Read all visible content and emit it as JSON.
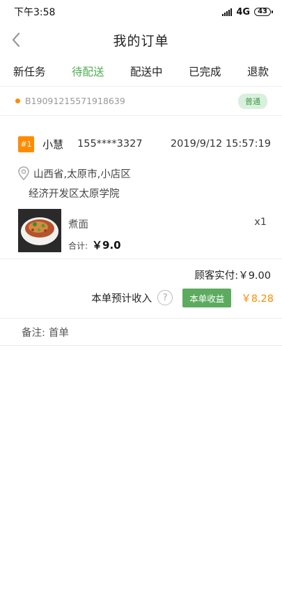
{
  "status_bar": {
    "time": "下午3:58",
    "network": "4G",
    "battery": "43"
  },
  "header": {
    "title": "我的订单"
  },
  "tabs": [
    {
      "label": "新任务"
    },
    {
      "label": "待配送",
      "active": true
    },
    {
      "label": "配送中"
    },
    {
      "label": "已完成"
    },
    {
      "label": "退款"
    }
  ],
  "order": {
    "id": "B19091215571918639",
    "type_badge": "普通",
    "index": "#1",
    "customer_name": "小慧",
    "customer_phone": "155****3327",
    "time": "2019/9/12 15:57:19",
    "address_line1": "山西省,太原市,小店区",
    "address_line2": "经济开发区太原学院",
    "item": {
      "name": "煮面",
      "quantity": "x1",
      "total_label": "合计:",
      "total_value": "￥9.0"
    },
    "paid_label": "顾客实付:",
    "paid_value": "￥9.00",
    "income_label": "本单预计收入",
    "income_button": "本单收益",
    "income_value": "￥8.28",
    "remark_label": "备注:",
    "remark_value": "首单"
  },
  "colors": {
    "accent_green": "#4caf50",
    "accent_orange": "#ff8c00"
  }
}
